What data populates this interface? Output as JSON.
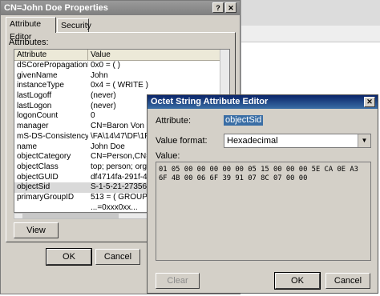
{
  "properties": {
    "title": "CN=John Doe Properties",
    "help_btn": "?",
    "close_btn": "✕",
    "tabs": [
      "Attribute Editor",
      "Security"
    ],
    "attributes_label": "Attributes:",
    "columns": [
      "Attribute",
      "Value"
    ],
    "rows": [
      [
        "dSCorePropagationD...",
        "0x0 = ( )"
      ],
      [
        "givenName",
        "John"
      ],
      [
        "instanceType",
        "0x4 = ( WRITE )"
      ],
      [
        "lastLogoff",
        "(never)"
      ],
      [
        "lastLogon",
        "(never)"
      ],
      [
        "logonCount",
        "0"
      ],
      [
        "manager",
        "CN=Baron Von Mur"
      ],
      [
        "mS-DS-ConsistencyG...",
        "\\FA\\14\\47\\DF\\1F\\"
      ],
      [
        "name",
        "John Doe"
      ],
      [
        "objectCategory",
        "CN=Person,CN=Sch"
      ],
      [
        "objectClass",
        "top; person; organiz"
      ],
      [
        "objectGUID",
        "df4714fa-291f-40fc"
      ],
      [
        "objectSid",
        "S-1-5-21-27356555"
      ],
      [
        "primaryGroupID",
        "513 = ( GROUP_RI"
      ],
      [
        "",
        "...=0xxx0xx..."
      ]
    ],
    "view_btn": "View",
    "ok_btn": "OK",
    "cancel_btn": "Cancel"
  },
  "octet": {
    "title": "Octet String Attribute Editor",
    "close_btn": "✕",
    "attribute_label": "Attribute:",
    "attribute_value": "objectSid",
    "format_label": "Value format:",
    "format_value": "Hexadecimal",
    "value_label": "Value:",
    "hex_lines": [
      "01 05 00 00 00 00 00 05 15 00 00 00 5E CA 0E A3",
      "6F 4B 00 06 6F 39 91 07 8C 07 00 00"
    ],
    "clear_btn": "Clear",
    "ok_btn": "OK",
    "cancel_btn": "Cancel"
  }
}
